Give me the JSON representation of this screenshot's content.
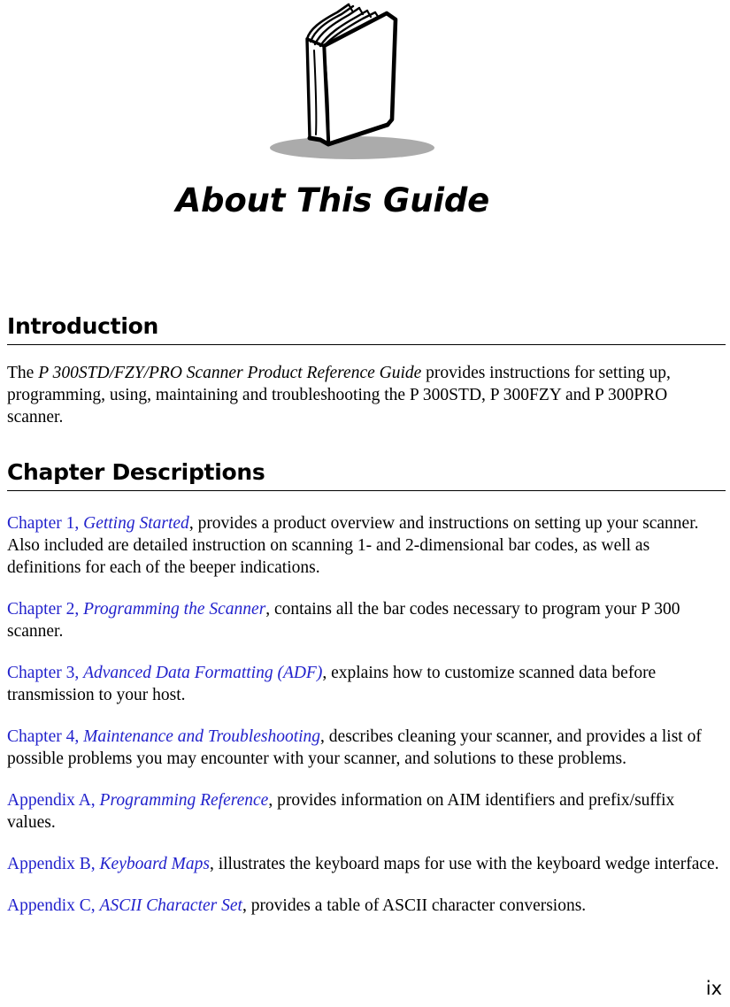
{
  "page": {
    "chapter_title": "About This Guide",
    "folio": "ix",
    "art": {
      "name": "open-book-illustration",
      "shadow_color": "#ABABAB",
      "line_color": "#000000"
    }
  },
  "sections": [
    {
      "heading": "Introduction",
      "paragraph": {
        "lead": "The ",
        "book_title": "P 300STD/FZY/PRO Scanner Product Reference Guide",
        "rest": " provides instructions for setting up, programming, using, maintaining and troubleshooting the P 300STD, P 300FZY and P 300PRO scanner."
      }
    },
    {
      "heading": "Chapter Descriptions"
    }
  ],
  "chapters": [
    {
      "ref": "Chapter 1, ",
      "title": "Getting Started",
      "description": ", provides a product overview and instructions on setting up your scanner. Also included are detailed instruction on scanning 1- and 2-dimensional bar codes, as well as definitions for each of the beeper indications."
    },
    {
      "ref": "Chapter 2, ",
      "title": "Programming the Scanner",
      "description": ", contains all the bar codes necessary to program your P 300 scanner."
    },
    {
      "ref": "Chapter 3, ",
      "title": "Advanced Data Formatting (ADF)",
      "description": ", explains how to customize scanned data before transmission to your host."
    },
    {
      "ref": "Chapter 4, ",
      "title": "Maintenance and Troubleshooting",
      "description": ", describes cleaning your scanner, and provides a list of possible problems you may encounter with your scanner, and solutions to these problems."
    },
    {
      "ref": "Appendix A, ",
      "title": "Programming Reference",
      "description": ", provides information on AIM identifiers and prefix/suffix values."
    },
    {
      "ref": "Appendix B, ",
      "title": "Keyboard Maps",
      "description": ", illustrates the keyboard maps for use with the keyboard wedge interface."
    },
    {
      "ref": "Appendix C, ",
      "title": "ASCII Character Set",
      "description": ", provides a table of ASCII character conversions."
    }
  ],
  "colors": {
    "link_blue": "#2222CC",
    "text_black": "#000000",
    "shadow_gray": "#ABABAB"
  }
}
